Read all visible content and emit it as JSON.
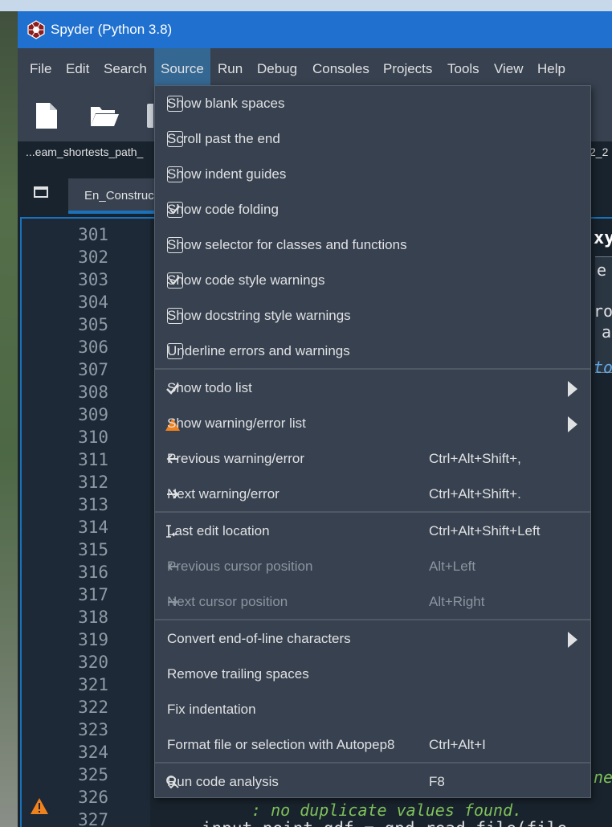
{
  "window": {
    "title": "Spyder (Python 3.8)"
  },
  "menubar": {
    "items": [
      "File",
      "Edit",
      "Search",
      "Source",
      "Run",
      "Debug",
      "Consoles",
      "Projects",
      "Tools",
      "View",
      "Help"
    ],
    "active": "Source"
  },
  "toolbar": {
    "buttons": [
      "new-file-icon",
      "open-folder-icon"
    ]
  },
  "pathbar": {
    "left": "...eam_shortests_path_",
    "right": "2_2"
  },
  "tabs": {
    "file_tab": "En_Construc"
  },
  "editor": {
    "line_numbers": [
      "301",
      "302",
      "303",
      "304",
      "305",
      "306",
      "307",
      "308",
      "309",
      "310",
      "311",
      "312",
      "313",
      "314",
      "315",
      "316",
      "317",
      "318",
      "319",
      "320",
      "321",
      "322",
      "323",
      "324",
      "325",
      "326",
      "327"
    ],
    "warning_line": "326",
    "code_fragments": {
      "frag_xy": "xy",
      "frag_e": "e",
      "frag_ro": "ro",
      "frag_a": "a",
      "frag_tod": "tod",
      "frag_ned": "ned",
      "line_326_comment": ": no duplicate values found.",
      "line_327": "input_point_gdf = gpd.read_file(file"
    }
  },
  "source_menu": {
    "section1": [
      {
        "label": "Show blank spaces",
        "checked": false
      },
      {
        "label": "Scroll past the end",
        "checked": false
      },
      {
        "label": "Show indent guides",
        "checked": false
      },
      {
        "label": "Show code folding",
        "checked": true
      },
      {
        "label": "Show selector for classes and functions",
        "checked": false
      },
      {
        "label": "Show code style warnings",
        "checked": true
      },
      {
        "label": "Show docstring style warnings",
        "checked": false
      },
      {
        "label": "Underline errors and warnings",
        "checked": false
      }
    ],
    "section2": [
      {
        "label": "Show todo list",
        "icon": "checkmark-icon",
        "submenu": true
      },
      {
        "label": "Show warning/error list",
        "icon": "warning-icon",
        "submenu": true
      },
      {
        "label": "Previous warning/error",
        "icon": "previous-arrow-icon",
        "shortcut": "Ctrl+Alt+Shift+,"
      },
      {
        "label": "Next warning/error",
        "icon": "next-arrow-icon",
        "shortcut": "Ctrl+Alt+Shift+."
      }
    ],
    "section3": [
      {
        "label": "Last edit location",
        "icon": "text-cursor-icon",
        "shortcut": "Ctrl+Alt+Shift+Left",
        "disabled": false
      },
      {
        "label": "Previous cursor position",
        "icon": "cursor-back-icon",
        "shortcut": "Alt+Left",
        "disabled": true
      },
      {
        "label": "Next cursor position",
        "icon": "cursor-forward-icon",
        "shortcut": "Alt+Right",
        "disabled": true
      }
    ],
    "section4": [
      {
        "label": "Convert end-of-line characters",
        "submenu": true
      },
      {
        "label": "Remove trailing spaces"
      },
      {
        "label": "Fix indentation"
      },
      {
        "label": "Format file or selection with Autopep8",
        "shortcut": "Ctrl+Alt+I"
      }
    ],
    "section5": [
      {
        "label": "Run code analysis",
        "icon": "code-analysis-icon",
        "shortcut": "F8"
      }
    ]
  },
  "colors": {
    "titlebar": "#1f70cf",
    "menu_bg": "#37414f",
    "menu_active": "#346792",
    "editor_bg": "#19232d",
    "accent_blue": "#1a72bb",
    "warning_orange": "#f0821e"
  }
}
